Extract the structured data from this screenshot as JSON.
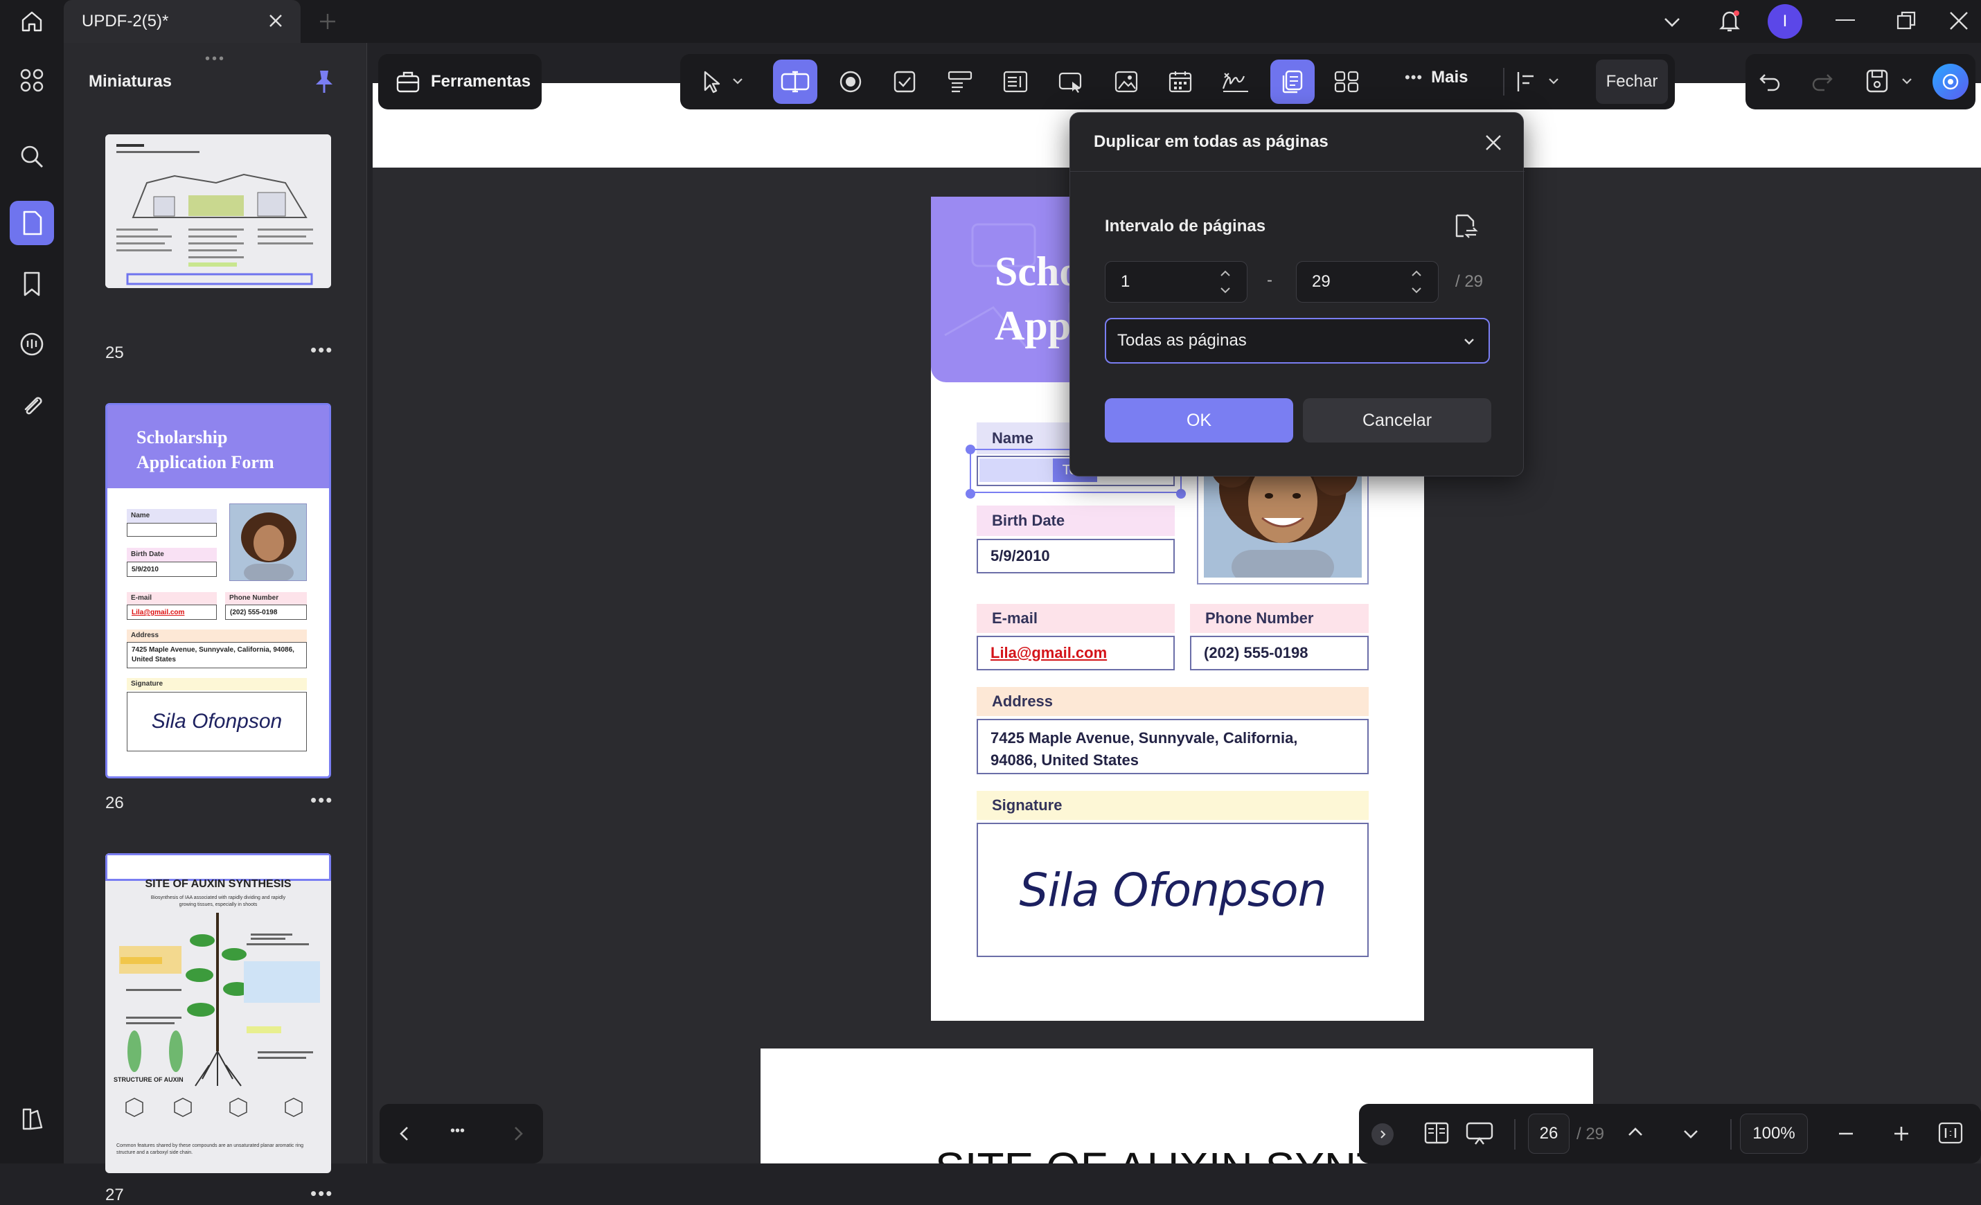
{
  "titlebar": {
    "tab_title": "UPDF-2(5)*",
    "avatar_letter": "I"
  },
  "panel": {
    "title": "Miniaturas",
    "thumbs": [
      {
        "number": "25"
      },
      {
        "number": "26",
        "title_line1": "Scholarship",
        "title_line2": "Application Form",
        "name_label": "Name",
        "birth_label": "Birth Date",
        "birth_value": "5/9/2010",
        "email_label": "E-mail",
        "email_value": "Lila@gmail.com",
        "phone_label": "Phone Number",
        "phone_value": "(202) 555-0198",
        "address_label": "Address",
        "address_value": "7425 Maple Avenue, Sunnyvale, California, 94086, United States",
        "signature_label": "Signature",
        "signature_value": "Sila Ofonpson"
      },
      {
        "number": "27",
        "heading": "SITE OF AUXIN SYNTHESIS",
        "subtitle": "Biosynthesis of IAA associated with rapidly dividing and rapidly growing tissues, especially in shoots",
        "section": "STRUCTURE OF AUXIN",
        "footer": "Common features shared by these compounds are an unsaturated planar aromatic ring structure and a carboxyl side chain."
      }
    ]
  },
  "toolbar": {
    "tools_label": "Ferramentas",
    "more_label": "Mais",
    "close_label": "Fechar"
  },
  "document": {
    "header_line1": "Scho",
    "header_line2": "App",
    "name_label": "Name",
    "text_tag": "Text",
    "birth_label": "Birth Date",
    "birth_value": "5/9/2010",
    "email_label": "E-mail",
    "email_value": "Lila@gmail.com",
    "phone_label": "Phone Number",
    "phone_value": "(202) 555-0198",
    "address_label": "Address",
    "address_line1": "7425 Maple Avenue, Sunnyvale, California,",
    "address_line2": "94086, United States",
    "signature_label": "Signature",
    "signature_value": "Sila Ofonpson",
    "next_page_heading": "SITE OF AUXIN SYNTHESIS"
  },
  "dialog": {
    "title": "Duplicar em todas as páginas",
    "range_label": "Intervalo de páginas",
    "from_value": "1",
    "separator": "-",
    "to_value": "29",
    "total": "/ 29",
    "select_value": "Todas as páginas",
    "ok_label": "OK",
    "cancel_label": "Cancelar"
  },
  "bottombar": {
    "page_current": "26",
    "page_total": "/ 29",
    "zoom": "100%"
  },
  "colors": {
    "accent": "#7a7ef2",
    "accent_dark": "#6265e6",
    "header_purple": "#9b8af2",
    "name_bg": "#e4e3f8",
    "birth_bg": "#f9e1f4",
    "email_bg": "#fde3ea",
    "address_bg": "#fde8d6",
    "signature_bg": "#fdf7d6"
  }
}
